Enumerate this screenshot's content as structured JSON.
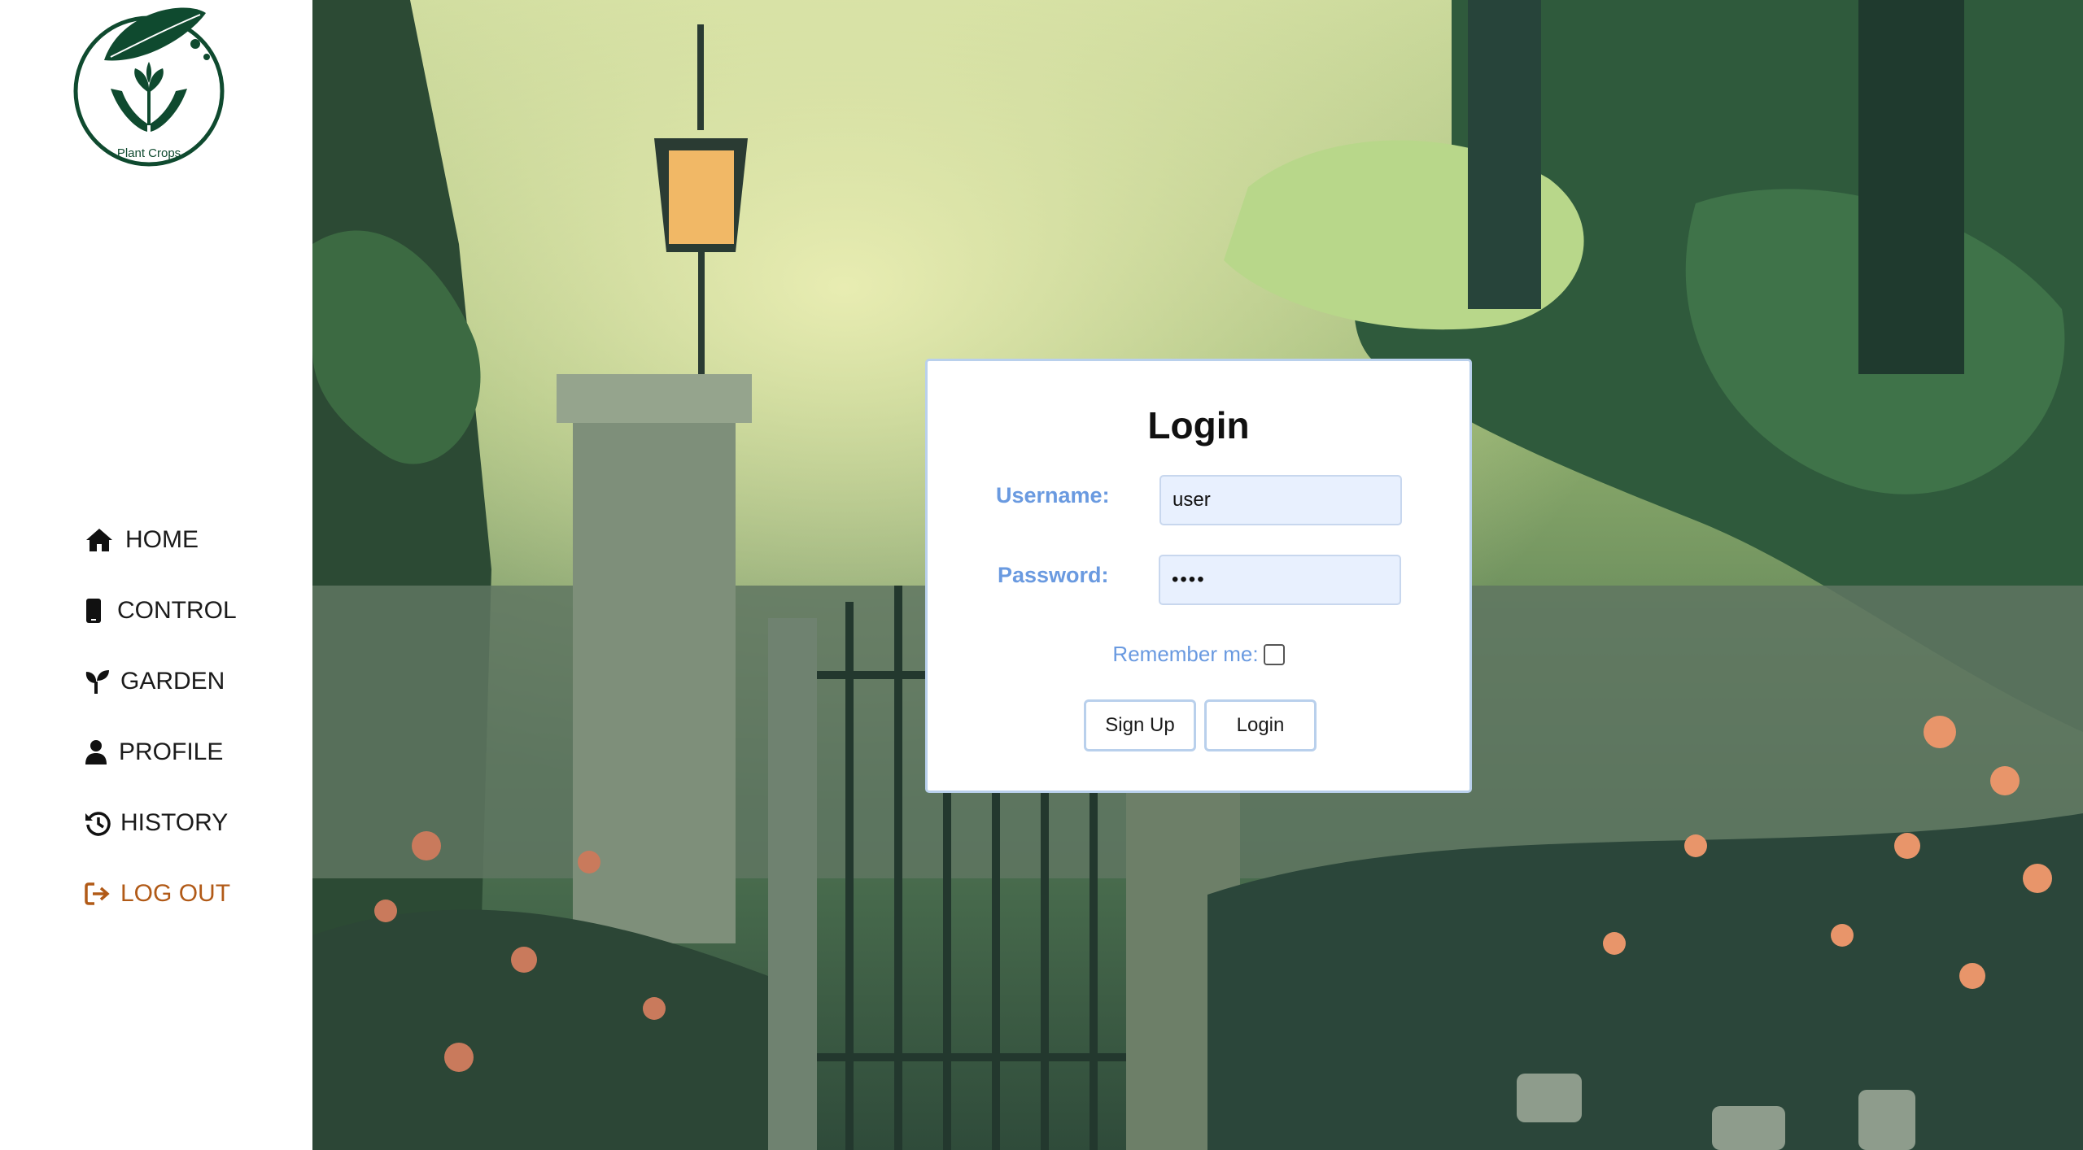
{
  "brand": {
    "logo_text": "Plant Crops",
    "color": "#0f4a2f"
  },
  "sidebar": {
    "items": [
      {
        "label": "HOME",
        "icon": "home-icon"
      },
      {
        "label": "CONTROL",
        "icon": "phone-icon"
      },
      {
        "label": "GARDEN",
        "icon": "seedling-icon"
      },
      {
        "label": "PROFILE",
        "icon": "user-icon"
      },
      {
        "label": "HISTORY",
        "icon": "history-icon"
      }
    ],
    "logout": {
      "label": "LOG OUT",
      "icon": "logout-icon",
      "color": "#b15a17"
    }
  },
  "login": {
    "title": "Login",
    "username_label": "Username:",
    "username_value": "user",
    "password_label": "Password:",
    "password_value": "••••",
    "remember_label": "Remember me:",
    "remember_checked": false,
    "signup_label": "Sign Up",
    "login_label": "Login",
    "accent_color": "#6a9ae0"
  }
}
